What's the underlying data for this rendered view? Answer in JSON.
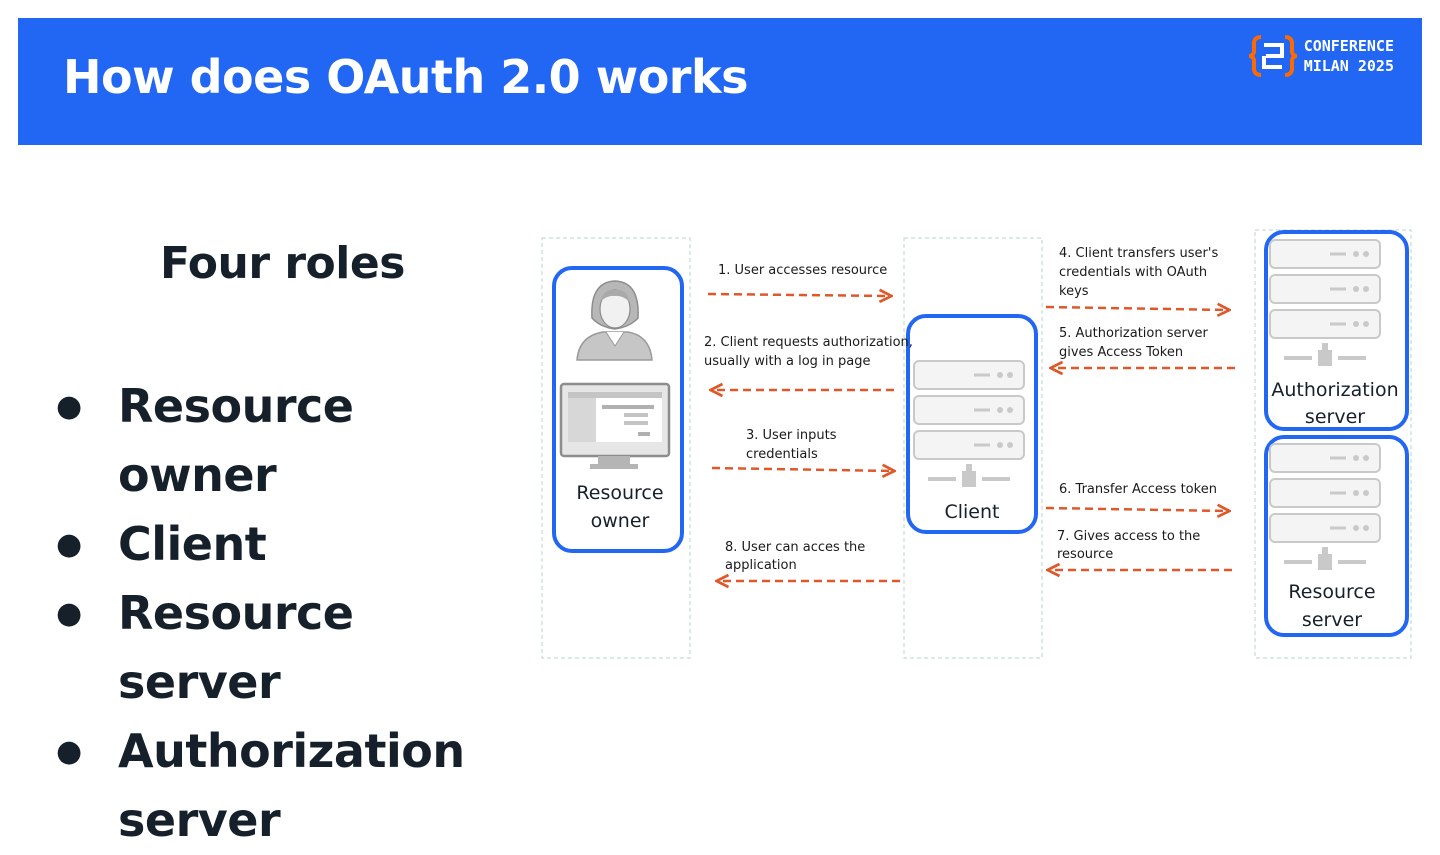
{
  "slide": {
    "title": "How does OAuth 2.0 works",
    "logo": {
      "line1": "CONFERENCE",
      "line2": "MILAN 2025",
      "accent": "#ff6a00"
    },
    "subtitle": "Four roles",
    "roles": [
      {
        "bullet": "●",
        "label": "Resource owner"
      },
      {
        "bullet": "●",
        "label": "Client"
      },
      {
        "bullet": "●",
        "label": "Resource server"
      },
      {
        "bullet": "●",
        "label": "Authorization server"
      }
    ]
  },
  "colors": {
    "header": "#2167f3",
    "box_border": "#2167f3",
    "arrow": "#e0582a",
    "text": "#15202b",
    "server_grey": "#c9c9c9"
  },
  "diagram": {
    "nodes": {
      "resource_owner": {
        "line1": "Resource",
        "line2": "owner",
        "icon": "user-at-computer-icon"
      },
      "client": {
        "label": "Client",
        "icon": "server-icon"
      },
      "authorization_server": {
        "line1": "Authorization",
        "line2": "server",
        "icon": "server-icon"
      },
      "resource_server": {
        "line1": "Resource",
        "line2": "server",
        "icon": "server-icon"
      }
    },
    "steps": {
      "s1": {
        "l1": "1. User accesses resource"
      },
      "s2": {
        "l1": "2. Client requests authorization,",
        "l2": "usually with a log in page"
      },
      "s3": {
        "l1": "3. User inputs",
        "l2": "credentials"
      },
      "s4": {
        "l1": "4. Client transfers user's",
        "l2": "credentials with OAuth",
        "l3": "keys"
      },
      "s5": {
        "l1": "5. Authorization server",
        "l2": "gives Access Token"
      },
      "s6": {
        "l1": "6. Transfer Access token"
      },
      "s7": {
        "l1": "7. Gives access to the",
        "l2": "resource"
      },
      "s8": {
        "l1": "8. User can acces the",
        "l2": "application"
      }
    }
  }
}
